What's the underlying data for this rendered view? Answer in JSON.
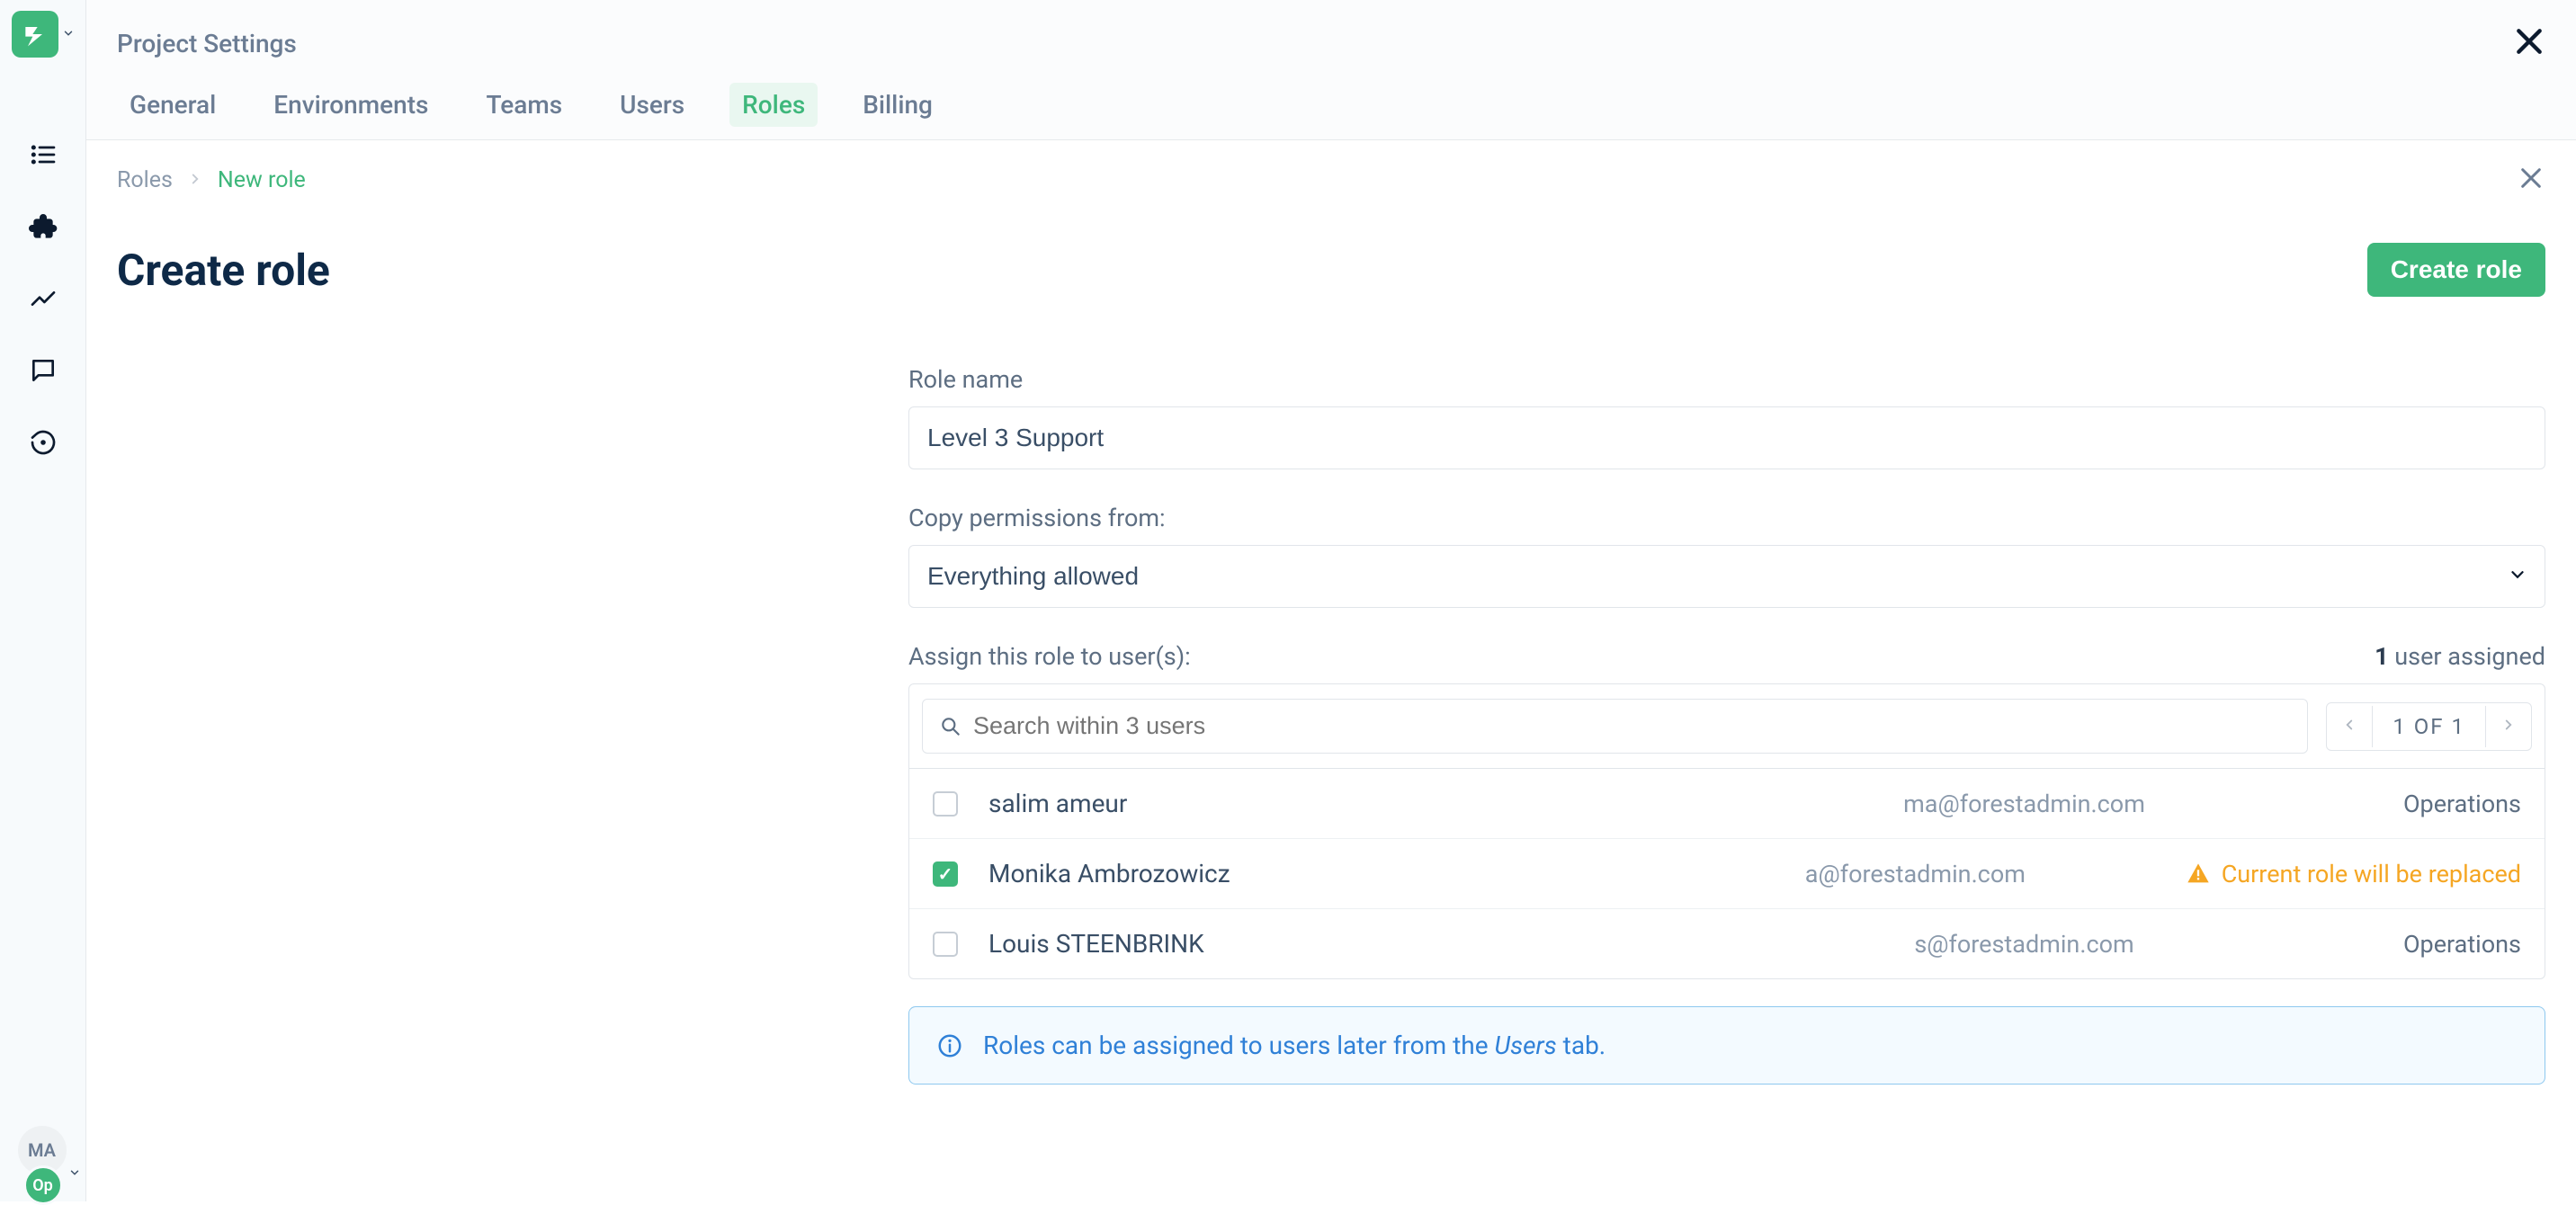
{
  "header": {
    "title": "Project Settings",
    "tabs": [
      "General",
      "Environments",
      "Teams",
      "Users",
      "Roles",
      "Billing"
    ],
    "active_tab_index": 4
  },
  "breadcrumb": {
    "root": "Roles",
    "current": "New role"
  },
  "page": {
    "heading": "Create role",
    "create_button": "Create role"
  },
  "form": {
    "role_name_label": "Role name",
    "role_name_value": "Level 3 Support",
    "copy_label": "Copy permissions from:",
    "copy_value": "Everything allowed",
    "assign_label": "Assign this role to user(s):",
    "assigned_count": "1",
    "assigned_suffix": " user assigned",
    "search_placeholder": "Search within 3 users",
    "pager_label": "1 OF 1"
  },
  "users": [
    {
      "name": "salim ameur",
      "email": "ma@forestadmin.com",
      "role": "Operations",
      "checked": false,
      "warn": false
    },
    {
      "name": "Monika Ambrozowicz",
      "email": "a@forestadmin.com",
      "role": "",
      "checked": true,
      "warn": true,
      "warn_text": "Current role will be replaced"
    },
    {
      "name": "Louis STEENBRINK",
      "email": "s@forestadmin.com",
      "role": "Operations",
      "checked": false,
      "warn": false
    }
  ],
  "info": {
    "prefix": "Roles can be assigned to users later from the ",
    "link": "Users",
    "suffix": " tab."
  },
  "avatars": {
    "top": "MA",
    "bottom": "Op"
  }
}
